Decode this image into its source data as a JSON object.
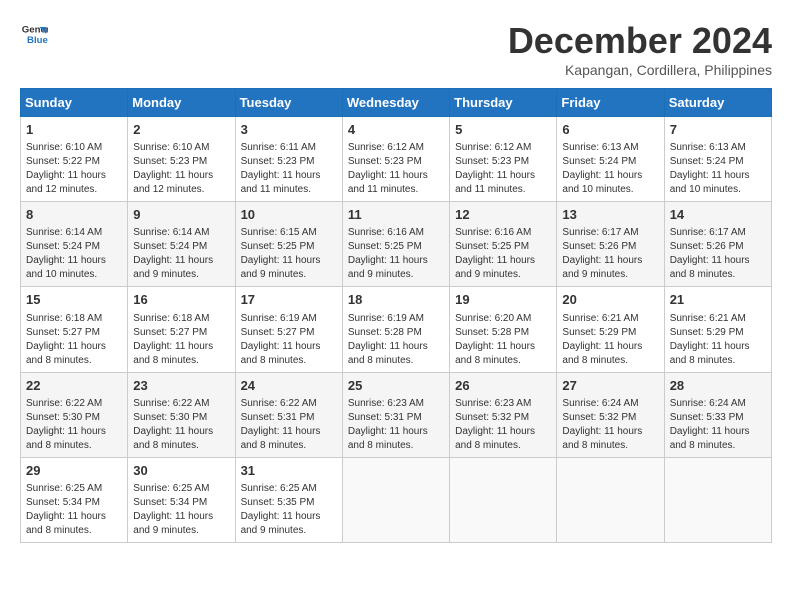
{
  "logo": {
    "line1": "General",
    "line2": "Blue"
  },
  "title": "December 2024",
  "subtitle": "Kapangan, Cordillera, Philippines",
  "days_header": [
    "Sunday",
    "Monday",
    "Tuesday",
    "Wednesday",
    "Thursday",
    "Friday",
    "Saturday"
  ],
  "weeks": [
    [
      {
        "day": "1",
        "info": "Sunrise: 6:10 AM\nSunset: 5:22 PM\nDaylight: 11 hours\nand 12 minutes."
      },
      {
        "day": "2",
        "info": "Sunrise: 6:10 AM\nSunset: 5:23 PM\nDaylight: 11 hours\nand 12 minutes."
      },
      {
        "day": "3",
        "info": "Sunrise: 6:11 AM\nSunset: 5:23 PM\nDaylight: 11 hours\nand 11 minutes."
      },
      {
        "day": "4",
        "info": "Sunrise: 6:12 AM\nSunset: 5:23 PM\nDaylight: 11 hours\nand 11 minutes."
      },
      {
        "day": "5",
        "info": "Sunrise: 6:12 AM\nSunset: 5:23 PM\nDaylight: 11 hours\nand 11 minutes."
      },
      {
        "day": "6",
        "info": "Sunrise: 6:13 AM\nSunset: 5:24 PM\nDaylight: 11 hours\nand 10 minutes."
      },
      {
        "day": "7",
        "info": "Sunrise: 6:13 AM\nSunset: 5:24 PM\nDaylight: 11 hours\nand 10 minutes."
      }
    ],
    [
      {
        "day": "8",
        "info": "Sunrise: 6:14 AM\nSunset: 5:24 PM\nDaylight: 11 hours\nand 10 minutes."
      },
      {
        "day": "9",
        "info": "Sunrise: 6:14 AM\nSunset: 5:24 PM\nDaylight: 11 hours\nand 9 minutes."
      },
      {
        "day": "10",
        "info": "Sunrise: 6:15 AM\nSunset: 5:25 PM\nDaylight: 11 hours\nand 9 minutes."
      },
      {
        "day": "11",
        "info": "Sunrise: 6:16 AM\nSunset: 5:25 PM\nDaylight: 11 hours\nand 9 minutes."
      },
      {
        "day": "12",
        "info": "Sunrise: 6:16 AM\nSunset: 5:25 PM\nDaylight: 11 hours\nand 9 minutes."
      },
      {
        "day": "13",
        "info": "Sunrise: 6:17 AM\nSunset: 5:26 PM\nDaylight: 11 hours\nand 9 minutes."
      },
      {
        "day": "14",
        "info": "Sunrise: 6:17 AM\nSunset: 5:26 PM\nDaylight: 11 hours\nand 8 minutes."
      }
    ],
    [
      {
        "day": "15",
        "info": "Sunrise: 6:18 AM\nSunset: 5:27 PM\nDaylight: 11 hours\nand 8 minutes."
      },
      {
        "day": "16",
        "info": "Sunrise: 6:18 AM\nSunset: 5:27 PM\nDaylight: 11 hours\nand 8 minutes."
      },
      {
        "day": "17",
        "info": "Sunrise: 6:19 AM\nSunset: 5:27 PM\nDaylight: 11 hours\nand 8 minutes."
      },
      {
        "day": "18",
        "info": "Sunrise: 6:19 AM\nSunset: 5:28 PM\nDaylight: 11 hours\nand 8 minutes."
      },
      {
        "day": "19",
        "info": "Sunrise: 6:20 AM\nSunset: 5:28 PM\nDaylight: 11 hours\nand 8 minutes."
      },
      {
        "day": "20",
        "info": "Sunrise: 6:21 AM\nSunset: 5:29 PM\nDaylight: 11 hours\nand 8 minutes."
      },
      {
        "day": "21",
        "info": "Sunrise: 6:21 AM\nSunset: 5:29 PM\nDaylight: 11 hours\nand 8 minutes."
      }
    ],
    [
      {
        "day": "22",
        "info": "Sunrise: 6:22 AM\nSunset: 5:30 PM\nDaylight: 11 hours\nand 8 minutes."
      },
      {
        "day": "23",
        "info": "Sunrise: 6:22 AM\nSunset: 5:30 PM\nDaylight: 11 hours\nand 8 minutes."
      },
      {
        "day": "24",
        "info": "Sunrise: 6:22 AM\nSunset: 5:31 PM\nDaylight: 11 hours\nand 8 minutes."
      },
      {
        "day": "25",
        "info": "Sunrise: 6:23 AM\nSunset: 5:31 PM\nDaylight: 11 hours\nand 8 minutes."
      },
      {
        "day": "26",
        "info": "Sunrise: 6:23 AM\nSunset: 5:32 PM\nDaylight: 11 hours\nand 8 minutes."
      },
      {
        "day": "27",
        "info": "Sunrise: 6:24 AM\nSunset: 5:32 PM\nDaylight: 11 hours\nand 8 minutes."
      },
      {
        "day": "28",
        "info": "Sunrise: 6:24 AM\nSunset: 5:33 PM\nDaylight: 11 hours\nand 8 minutes."
      }
    ],
    [
      {
        "day": "29",
        "info": "Sunrise: 6:25 AM\nSunset: 5:34 PM\nDaylight: 11 hours\nand 8 minutes."
      },
      {
        "day": "30",
        "info": "Sunrise: 6:25 AM\nSunset: 5:34 PM\nDaylight: 11 hours\nand 9 minutes."
      },
      {
        "day": "31",
        "info": "Sunrise: 6:25 AM\nSunset: 5:35 PM\nDaylight: 11 hours\nand 9 minutes."
      },
      {
        "day": "",
        "info": ""
      },
      {
        "day": "",
        "info": ""
      },
      {
        "day": "",
        "info": ""
      },
      {
        "day": "",
        "info": ""
      }
    ]
  ]
}
